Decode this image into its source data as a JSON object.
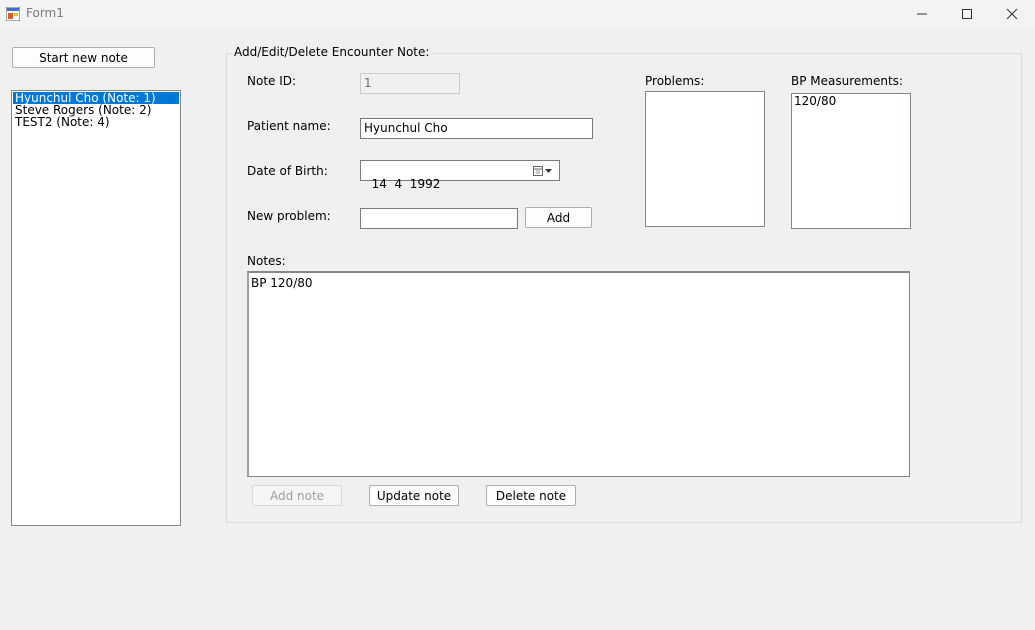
{
  "window": {
    "title": "Form1"
  },
  "sidebar": {
    "start_button": "Start new note",
    "items": [
      {
        "label": "Hyunchul Cho (Note: 1)"
      },
      {
        "label": "Steve Rogers (Note: 2)"
      },
      {
        "label": "TEST2 (Note: 4)"
      }
    ]
  },
  "form": {
    "group_title": "Add/Edit/Delete Encounter Note:",
    "note_id_label": "Note ID:",
    "note_id_value": "1",
    "patient_name_label": "Patient name:",
    "patient_name_value": "Hyunchul Cho",
    "dob_label": "Date of Birth:",
    "dob_value": "14  4  1992",
    "new_problem_label": "New problem:",
    "new_problem_value": "",
    "add_button": "Add",
    "problems_label": "Problems:",
    "problems": [],
    "bp_label": "BP Measurements:",
    "bp_items": [
      "120/80"
    ],
    "notes_label": "Notes:",
    "notes_value": "BP 120/80",
    "add_note_button": "Add note",
    "update_note_button": "Update note",
    "delete_note_button": "Delete note"
  },
  "colors": {
    "selection": "#0078d7",
    "background": "#f0f0f0"
  }
}
